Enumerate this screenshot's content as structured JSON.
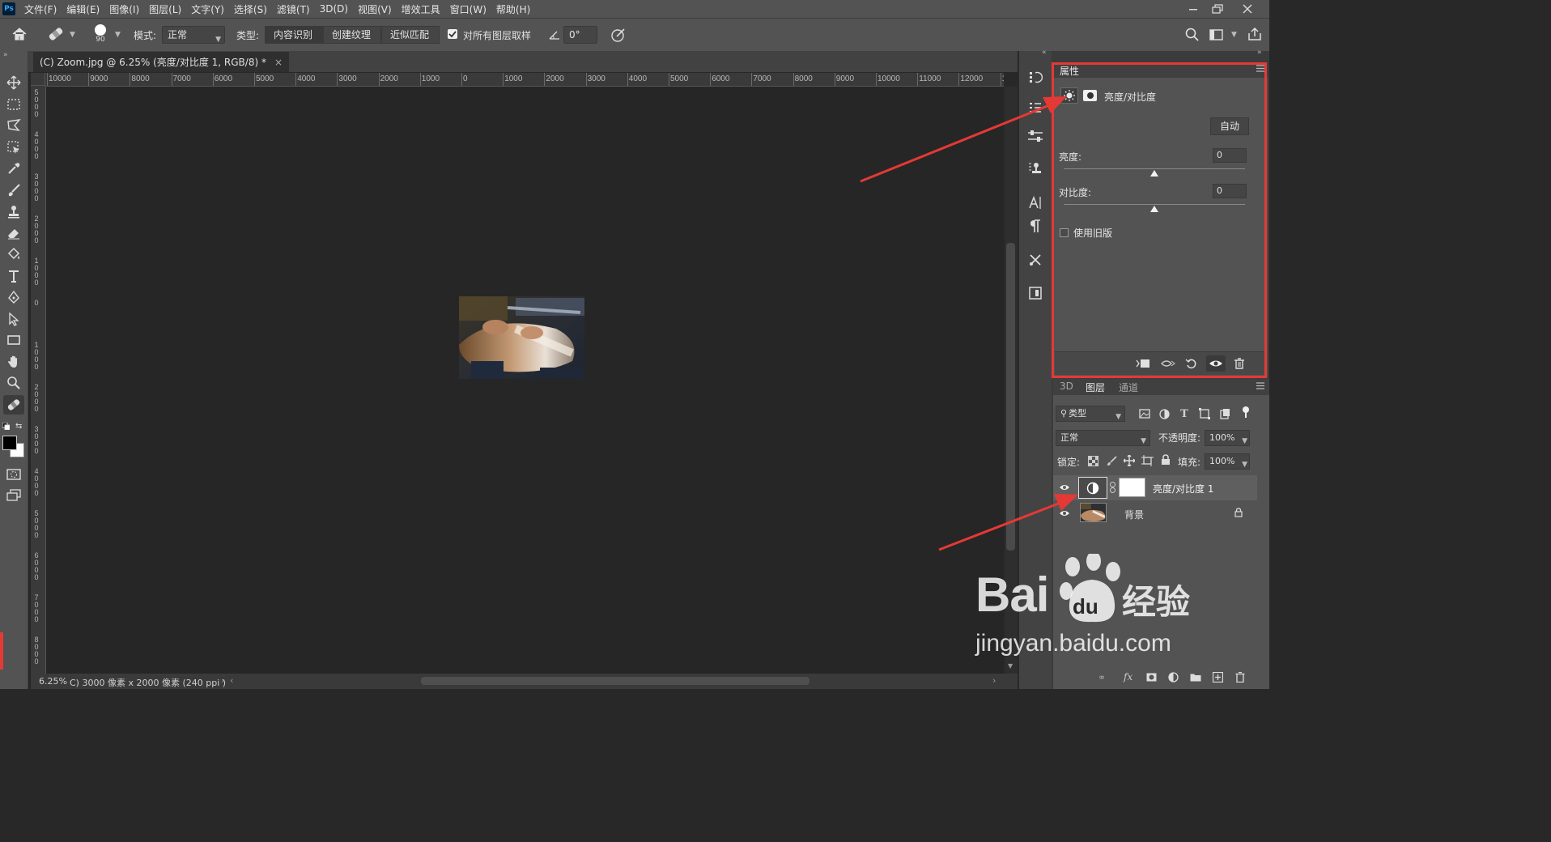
{
  "app": {
    "logo": "Ps",
    "menu": [
      "文件(F)",
      "编辑(E)",
      "图像(I)",
      "图层(L)",
      "文字(Y)",
      "选择(S)",
      "滤镜(T)",
      "3D(D)",
      "视图(V)",
      "增效工具",
      "窗口(W)",
      "帮助(H)"
    ]
  },
  "options": {
    "brush_size": "90",
    "mode_label": "模式:",
    "mode_value": "正常",
    "type_label": "类型:",
    "type_buttons": [
      "内容识别",
      "创建纹理",
      "近似匹配"
    ],
    "sample_all_label": "对所有图层取样",
    "sample_all_checked": true,
    "angle_value": "0°"
  },
  "document": {
    "tab_title": "(C) Zoom.jpg @ 6.25% (亮度/对比度 1, RGB/8) *",
    "zoom": "6.25%",
    "doc_info": "C) 3000 像素 x 2000 像素 (240 ppi )",
    "ruler_top": [
      "10000",
      "9000",
      "8000",
      "7000",
      "6000",
      "5000",
      "4000",
      "3000",
      "2000",
      "1000",
      "0",
      "1000",
      "2000",
      "3000",
      "4000",
      "5000",
      "6000",
      "7000",
      "8000",
      "9000",
      "10000",
      "11000",
      "12000",
      "1"
    ],
    "ruler_left": [
      "5000",
      "4000",
      "3000",
      "2000",
      "1000",
      "0",
      "1000",
      "2000",
      "3000",
      "4000",
      "5000",
      "6000",
      "7000",
      "8000"
    ]
  },
  "properties": {
    "panel_title": "属性",
    "adjustment_name": "亮度/对比度",
    "auto_label": "自动",
    "brightness_label": "亮度:",
    "brightness_value": "0",
    "contrast_label": "对比度:",
    "contrast_value": "0",
    "legacy_label": "使用旧版",
    "legacy_checked": false
  },
  "layers": {
    "tabs": [
      "3D",
      "图层",
      "通道"
    ],
    "active_tab": "图层",
    "filter_kind": "类型",
    "blend_mode": "正常",
    "opacity_label": "不透明度:",
    "opacity_value": "100%",
    "lock_label": "锁定:",
    "fill_label": "填充:",
    "fill_value": "100%",
    "items": [
      {
        "name": "亮度/对比度 1",
        "visible": true,
        "selected": true,
        "locked": false
      },
      {
        "name": "背景",
        "visible": true,
        "selected": false,
        "locked": true
      }
    ]
  },
  "watermark": {
    "brand": "Bai",
    "brand_tail": "经验",
    "paw_text": "du",
    "url": "jingyan.baidu.com"
  },
  "colors": {
    "annotation_red": "#e53935",
    "panel_bg": "#535353",
    "canvas_bg": "#262626"
  }
}
